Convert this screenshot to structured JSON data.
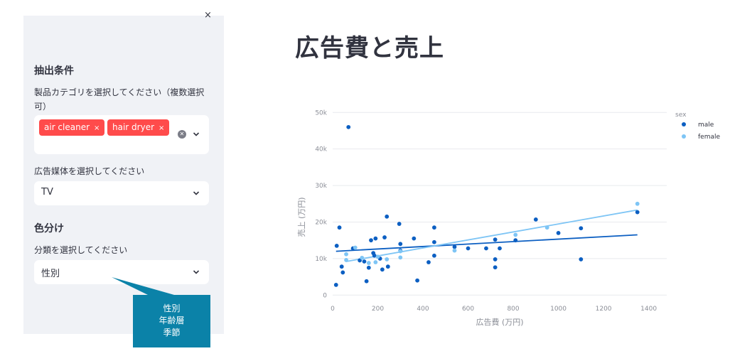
{
  "sidebar": {
    "close_label": "×",
    "filter_section_title": "抽出条件",
    "category_label": "製品カテゴリを選択してください（複数選択可）",
    "category_label_line1": "製品カテゴリを選択してください（複数選択",
    "category_label_line2": "可）",
    "category_chips": [
      "air cleaner",
      "hair dryer"
    ],
    "chip_remove": "×",
    "media_label": "広告媒体を選択してください",
    "media_value": "TV",
    "color_section_title": "色分け",
    "class_label": "分類を選択してください",
    "class_value": "性別",
    "class_options": [
      "性別",
      "年齢層",
      "季節"
    ]
  },
  "main": {
    "title": "広告費と売上"
  },
  "chart_data": {
    "type": "scatter",
    "xlabel": "広告費 (万円)",
    "ylabel": "売上 (万円)",
    "xlim": [
      0,
      1480
    ],
    "ylim": [
      -1500,
      52000
    ],
    "xticks": [
      0,
      200,
      400,
      600,
      800,
      1000,
      1200,
      1400
    ],
    "xtick_labels": [
      "0",
      "200",
      "400",
      "600",
      "800",
      "1000",
      "1200",
      "1400"
    ],
    "yticks": [
      0,
      10000,
      20000,
      30000,
      40000,
      50000
    ],
    "ytick_labels": [
      "0",
      "10k",
      "20k",
      "30k",
      "40k",
      "50k"
    ],
    "grid": true,
    "legend_title": "sex",
    "legend_position": "right",
    "series": [
      {
        "name": "male",
        "color": "#0c5fc2",
        "points": [
          [
            15,
            2800
          ],
          [
            18,
            13500
          ],
          [
            30,
            18500
          ],
          [
            40,
            7800
          ],
          [
            45,
            6200
          ],
          [
            70,
            46000
          ],
          [
            90,
            12800
          ],
          [
            120,
            9500
          ],
          [
            140,
            9200
          ],
          [
            150,
            3800
          ],
          [
            160,
            7500
          ],
          [
            170,
            15000
          ],
          [
            180,
            11500
          ],
          [
            185,
            10800
          ],
          [
            190,
            15500
          ],
          [
            210,
            10000
          ],
          [
            220,
            7000
          ],
          [
            230,
            15800
          ],
          [
            240,
            21500
          ],
          [
            245,
            7800
          ],
          [
            295,
            19500
          ],
          [
            300,
            12200
          ],
          [
            300,
            14000
          ],
          [
            360,
            15500
          ],
          [
            375,
            4000
          ],
          [
            425,
            9000
          ],
          [
            450,
            18500
          ],
          [
            450,
            14500
          ],
          [
            450,
            10800
          ],
          [
            540,
            13200
          ],
          [
            600,
            12800
          ],
          [
            680,
            12800
          ],
          [
            720,
            15200
          ],
          [
            720,
            9800
          ],
          [
            720,
            7600
          ],
          [
            740,
            12800
          ],
          [
            810,
            15000
          ],
          [
            900,
            20700
          ],
          [
            1000,
            17000
          ],
          [
            1100,
            18300
          ],
          [
            1100,
            9800
          ],
          [
            1350,
            22700
          ]
        ],
        "trend": [
          [
            15,
            12000
          ],
          [
            1350,
            16500
          ]
        ]
      },
      {
        "name": "female",
        "color": "#7ec5f5",
        "points": [
          [
            60,
            11200
          ],
          [
            60,
            9600
          ],
          [
            100,
            13000
          ],
          [
            130,
            10200
          ],
          [
            160,
            8800
          ],
          [
            190,
            9000
          ],
          [
            200,
            10500
          ],
          [
            240,
            9800
          ],
          [
            300,
            12000
          ],
          [
            300,
            10300
          ],
          [
            540,
            12200
          ],
          [
            810,
            16500
          ],
          [
            950,
            18500
          ],
          [
            1350,
            25000
          ]
        ],
        "trend": [
          [
            60,
            9200
          ],
          [
            1350,
            23300
          ]
        ]
      }
    ]
  }
}
